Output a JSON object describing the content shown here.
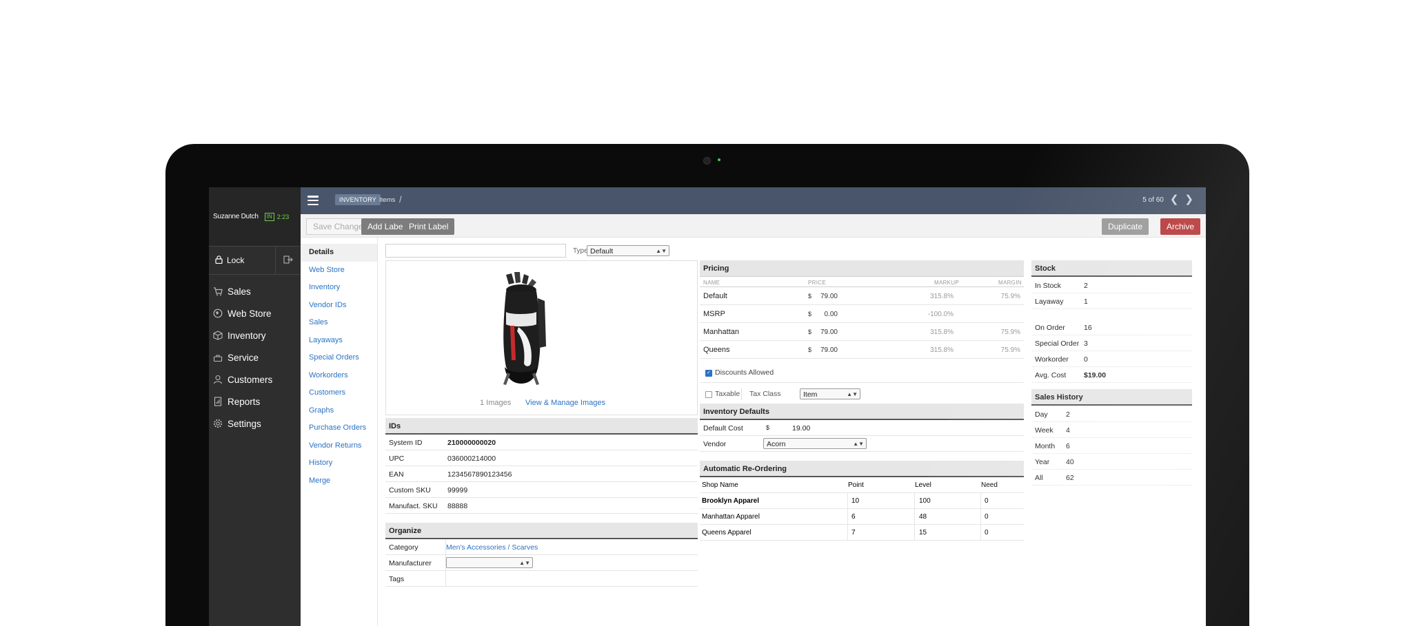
{
  "sidebar": {
    "user_name": "Suzanne Dutch",
    "clock_status": "IN",
    "clock_time": "2:23",
    "lock_label": "Lock",
    "items": [
      {
        "label": "Sales",
        "icon": "cart-icon"
      },
      {
        "label": "Web Store",
        "icon": "globe-icon"
      },
      {
        "label": "Inventory",
        "icon": "box-icon"
      },
      {
        "label": "Service",
        "icon": "wrench-icon"
      },
      {
        "label": "Customers",
        "icon": "person-icon"
      },
      {
        "label": "Reports",
        "icon": "report-icon"
      },
      {
        "label": "Settings",
        "icon": "gear-icon"
      }
    ]
  },
  "topbar": {
    "section": "INVENTORY",
    "page": "Items",
    "separator": "/",
    "pager": "5 of 60"
  },
  "toolbar": {
    "save": "Save Changes",
    "add_label": "Add Label",
    "print_label": "Print Label",
    "duplicate": "Duplicate",
    "archive": "Archive"
  },
  "subnav": [
    "Details",
    "Web Store",
    "Inventory",
    "Vendor IDs",
    "Sales",
    "Layaways",
    "Special Orders",
    "Workorders",
    "Customers",
    "Graphs",
    "Purchase Orders",
    "Vendor Returns",
    "History",
    "Merge"
  ],
  "item": {
    "type_label": "Type",
    "type_value": "Default",
    "image_count": "1 Images",
    "image_link": "View & Manage Images"
  },
  "ids": {
    "title": "IDs",
    "rows": [
      {
        "label": "System ID",
        "value": "210000000020"
      },
      {
        "label": "UPC",
        "value": "036000214000"
      },
      {
        "label": "EAN",
        "value": "1234567890123456"
      },
      {
        "label": "Custom SKU",
        "value": "99999"
      },
      {
        "label": "Manufact. SKU",
        "value": "88888"
      }
    ]
  },
  "organize": {
    "title": "Organize",
    "category_label": "Category",
    "category_value": "Men's Accessories / Scarves",
    "manufacturer_label": "Manufacturer",
    "tags_label": "Tags"
  },
  "pricing": {
    "title": "Pricing",
    "headers": {
      "name": "NAME",
      "price": "PRICE",
      "markup": "MARKUP",
      "margin": "MARGIN"
    },
    "currency": "$",
    "rows": [
      {
        "name": "Default",
        "price": "79.00",
        "markup": "315.8%",
        "margin": "75.9%"
      },
      {
        "name": "MSRP",
        "price": "0.00",
        "markup": "-100.0%",
        "margin": ""
      },
      {
        "name": "Manhattan",
        "price": "79.00",
        "markup": "315.8%",
        "margin": "75.9%"
      },
      {
        "name": "Queens",
        "price": "79.00",
        "markup": "315.8%",
        "margin": "75.9%"
      }
    ],
    "discounts_label": "Discounts Allowed",
    "discounts_checked": true,
    "taxable_label": "Taxable",
    "taxable_checked": false,
    "tax_class_label": "Tax Class",
    "tax_class_value": "Item"
  },
  "inventory_defaults": {
    "title": "Inventory Defaults",
    "cost_label": "Default Cost",
    "cost_currency": "$",
    "cost_value": "19.00",
    "vendor_label": "Vendor",
    "vendor_value": "Acorn"
  },
  "reordering": {
    "title": "Automatic Re-Ordering",
    "headers": {
      "shop": "Shop Name",
      "point": "Point",
      "level": "Level",
      "need": "Need"
    },
    "rows": [
      {
        "shop": "Brooklyn Apparel",
        "point": "10",
        "level": "100",
        "need": "0"
      },
      {
        "shop": "Manhattan Apparel",
        "point": "6",
        "level": "48",
        "need": "0"
      },
      {
        "shop": "Queens Apparel",
        "point": "7",
        "level": "15",
        "need": "0"
      }
    ]
  },
  "stock": {
    "title": "Stock",
    "rows": [
      {
        "label": "In Stock",
        "value": "2"
      },
      {
        "label": "Layaway",
        "value": "1"
      },
      {
        "label": "On Order",
        "value": "16"
      },
      {
        "label": "Special Order",
        "value": "3"
      },
      {
        "label": "Workorder",
        "value": "0"
      },
      {
        "label": "Avg. Cost",
        "value": "$19.00"
      }
    ]
  },
  "sales_history": {
    "title": "Sales History",
    "rows": [
      {
        "label": "Day",
        "value": "2"
      },
      {
        "label": "Week",
        "value": "4"
      },
      {
        "label": "Month",
        "value": "6"
      },
      {
        "label": "Year",
        "value": "40"
      },
      {
        "label": "All",
        "value": "62"
      }
    ]
  },
  "colors": {
    "topbar": "#49556a",
    "sidebar": "#2e2e2e",
    "link": "#2a72c4",
    "archive": "#b8393a",
    "clock": "#6fd24a"
  }
}
